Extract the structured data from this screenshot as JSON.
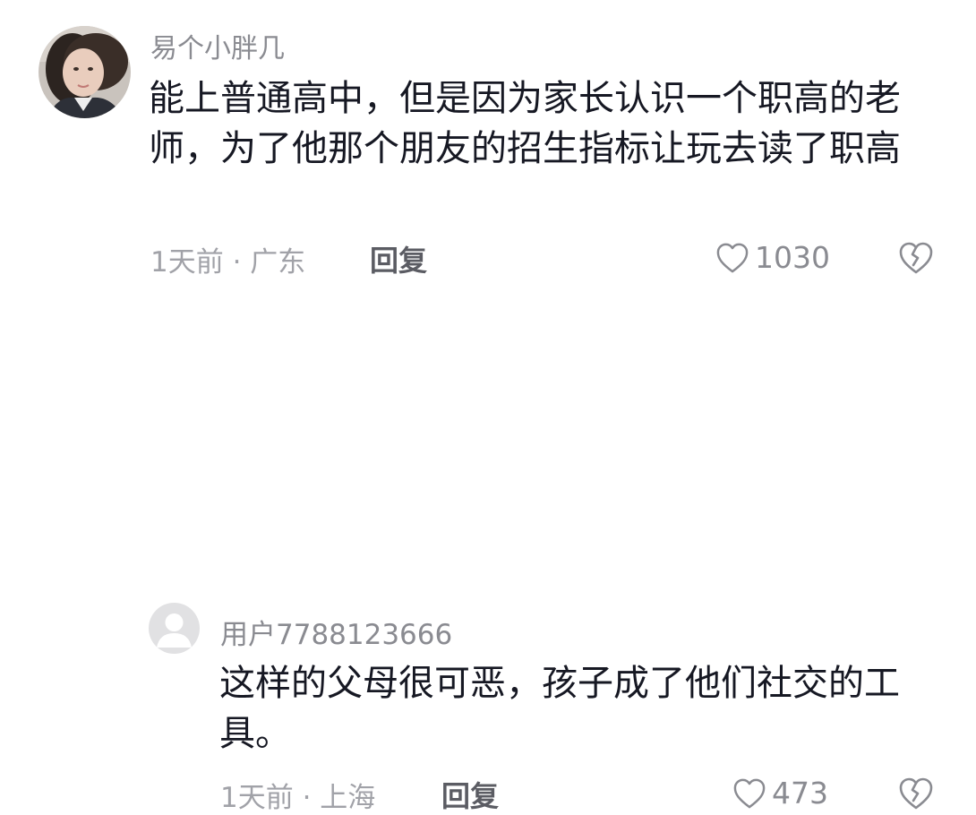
{
  "comments": [
    {
      "username": "易个小胖几",
      "content": "能上普通高中，但是因为家长认识一个职高的老师，为了他那个朋友的招生指标让玩去读了职高",
      "meta": "1天前 · 广东",
      "reply_label": "回复",
      "likes": "1030",
      "avatar_icon": "user-photo-avatar",
      "like_icon": "heart-outline-icon",
      "dislike_icon": "broken-heart-icon"
    },
    {
      "username": "用户7788123666",
      "content": "这样的父母很可恶，孩子成了他们社交的工具。",
      "meta": "1天前 · 上海",
      "reply_label": "回复",
      "likes": "473",
      "avatar_icon": "default-user-avatar",
      "like_icon": "heart-outline-icon",
      "dislike_icon": "broken-heart-icon"
    }
  ],
  "colors": {
    "text_primary": "#161823",
    "text_secondary": "#8a8b91",
    "text_tertiary": "#a1a2a8",
    "reply_text": "#5b5c63",
    "default_avatar_bg": "#e1e1e3"
  }
}
